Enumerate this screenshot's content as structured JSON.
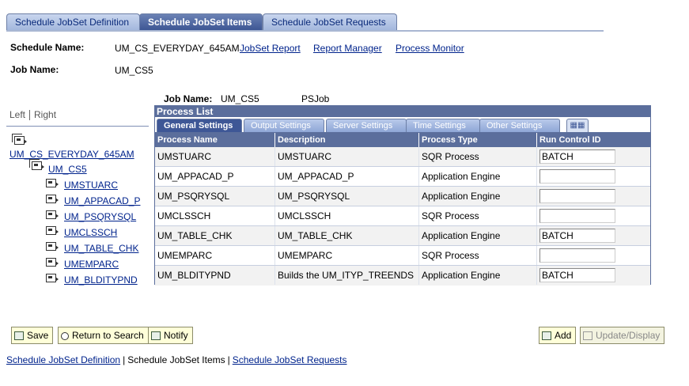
{
  "tabs": [
    {
      "label": "Schedule JobSet Definition",
      "active": false
    },
    {
      "label": "Schedule JobSet Items",
      "active": true
    },
    {
      "label": "Schedule JobSet Requests",
      "active": false
    }
  ],
  "header": {
    "schedule_name_label": "Schedule Name:",
    "schedule_name_value": "UM_CS_EVERYDAY_645AM",
    "job_name_label": "Job Name:",
    "job_name_value": "UM_CS5",
    "links": {
      "jobset_report": "JobSet Report",
      "report_manager": "Report Manager",
      "process_monitor": "Process Monitor"
    }
  },
  "tree": {
    "left_label": "Left",
    "right_label": "Right",
    "root": "UM_CS_EVERYDAY_645AM",
    "job": "UM_CS5",
    "items": [
      "UMSTUARC",
      "UM_APPACAD_P",
      "UM_PSQRYSQL",
      "UMCLSSCH",
      "UM_TABLE_CHK",
      "UMEMPARC",
      "UM_BLDITYPND"
    ]
  },
  "process_list": {
    "job_name_label": "Job Name:",
    "job_name_value": "UM_CS5",
    "job_type": "PSJob",
    "title": "Process List",
    "subtabs": [
      "General Settings",
      "Output Settings",
      "Server Settings",
      "Time Settings",
      "Other Settings"
    ],
    "columns": [
      "Process Name",
      "Description",
      "Process Type",
      "Run Control ID"
    ],
    "rows": [
      {
        "process_name": "UMSTUARC",
        "description": "UMSTUARC",
        "process_type": "SQR Process",
        "run_control_id": "BATCH"
      },
      {
        "process_name": "UM_APPACAD_P",
        "description": "UM_APPACAD_P",
        "process_type": "Application Engine",
        "run_control_id": ""
      },
      {
        "process_name": "UM_PSQRYSQL",
        "description": "UM_PSQRYSQL",
        "process_type": "Application Engine",
        "run_control_id": ""
      },
      {
        "process_name": "UMCLSSCH",
        "description": "UMCLSSCH",
        "process_type": "SQR Process",
        "run_control_id": ""
      },
      {
        "process_name": "UM_TABLE_CHK",
        "description": "UM_TABLE_CHK",
        "process_type": "Application Engine",
        "run_control_id": "BATCH"
      },
      {
        "process_name": "UMEMPARC",
        "description": "UMEMPARC",
        "process_type": "SQR Process",
        "run_control_id": ""
      },
      {
        "process_name": "UM_BLDITYPND",
        "description": "Builds the UM_ITYP_TREENDS",
        "process_type": "Application Engine",
        "run_control_id": "BATCH"
      }
    ]
  },
  "buttons": {
    "save": "Save",
    "return_to_search": "Return to Search",
    "notify": "Notify",
    "add": "Add",
    "update_display": "Update/Display"
  },
  "bottom_links": [
    "Schedule JobSet Definition",
    "Schedule JobSet Items",
    "Schedule JobSet Requests"
  ]
}
